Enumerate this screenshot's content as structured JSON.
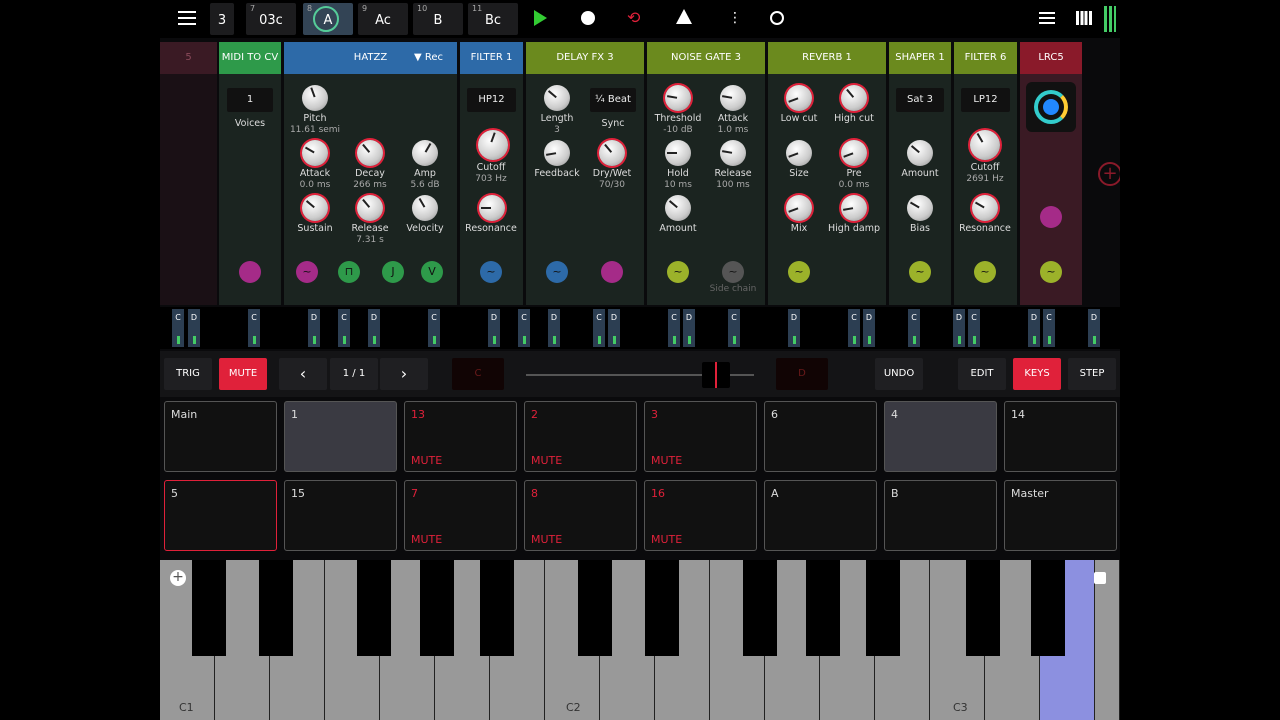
{
  "top": {
    "tabs": [
      {
        "num": "",
        "name": "3"
      },
      {
        "num": "7",
        "name": "03c"
      },
      {
        "num": "8",
        "name": "A"
      },
      {
        "num": "9",
        "name": "Ac"
      },
      {
        "num": "10",
        "name": "B"
      },
      {
        "num": "11",
        "name": "Bc"
      }
    ],
    "icons": [
      "hamburger-icon",
      "play-icon",
      "record-icon",
      "loop-icon",
      "metronome-icon",
      "more-icon",
      "link-icon",
      "list-icon",
      "grid-icon",
      "level-meter-icon"
    ]
  },
  "modules": {
    "m0": {
      "title": "5"
    },
    "midi": {
      "title": "MIDI TO CV",
      "voices_value": "1",
      "voices_label": "Voices"
    },
    "hatzz": {
      "title": "HATZZ",
      "rec": "▼ Rec",
      "pitch": "Pitch",
      "pitch_v": "11.61 semi",
      "attack": "Attack",
      "attack_v": "0.0 ms",
      "decay": "Decay",
      "decay_v": "266 ms",
      "amp": "Amp",
      "amp_v": "5.6 dB",
      "sustain": "Sustain",
      "release": "Release",
      "release_v": "7.31 s",
      "velocity": "Velocity",
      "lfo3": "J",
      "lfo4": "V"
    },
    "filter1": {
      "title": "FILTER 1",
      "mode": "HP12",
      "cutoff": "Cutoff",
      "cutoff_v": "703 Hz",
      "res": "Resonance"
    },
    "delay": {
      "title": "DELAY FX 3",
      "length": "Length",
      "length_v": "3",
      "sync_box": "¼ Beat",
      "sync": "Sync",
      "feedback": "Feedback",
      "drywet": "Dry/Wet",
      "drywet_v": "70/30"
    },
    "gate": {
      "title": "NOISE GATE 3",
      "threshold": "Threshold",
      "threshold_v": "-10 dB",
      "attack": "Attack",
      "attack_v": "1.0 ms",
      "hold": "Hold",
      "hold_v": "10 ms",
      "release": "Release",
      "release_v": "100 ms",
      "amount": "Amount",
      "sidechain": "Side chain"
    },
    "reverb": {
      "title": "REVERB 1",
      "lowcut": "Low cut",
      "highcut": "High cut",
      "size": "Size",
      "pre": "Pre",
      "pre_v": "0.0 ms",
      "mix": "Mix",
      "highdamp": "High damp"
    },
    "shaper": {
      "title": "SHAPER 1",
      "mode": "Sat 3",
      "amount": "Amount",
      "bias": "Bias"
    },
    "filter6": {
      "title": "FILTER 6",
      "mode": "LP12",
      "cutoff": "Cutoff",
      "cutoff_v": "2691 Hz",
      "res": "Resonance"
    },
    "lrc5": {
      "title": "LRC5"
    }
  },
  "minikeys": [
    "C",
    "D",
    "C",
    "D",
    "C",
    "D",
    "C",
    "D",
    "C",
    "D",
    "C",
    "D",
    "C",
    "D",
    "C",
    "D",
    "C",
    "D",
    "C",
    "D",
    "C",
    "D",
    "C",
    "D",
    "C",
    "D",
    "C",
    "D",
    "C",
    "D"
  ],
  "controls": {
    "trig": "TRIG",
    "mute": "MUTE",
    "prev": "‹",
    "page": "1 / 1",
    "next": "›",
    "left_note": "C",
    "right_note": "D",
    "undo": "UNDO",
    "edit": "EDIT",
    "keys": "KEYS",
    "step": "STEP"
  },
  "pads": [
    {
      "name": "Main",
      "mute": ""
    },
    {
      "name": "1",
      "mute": ""
    },
    {
      "name": "13",
      "mute": "MUTE"
    },
    {
      "name": "2",
      "mute": "MUTE"
    },
    {
      "name": "3",
      "mute": "MUTE"
    },
    {
      "name": "6",
      "mute": ""
    },
    {
      "name": "4",
      "mute": ""
    },
    {
      "name": "14",
      "mute": ""
    },
    {
      "name": "5",
      "mute": ""
    },
    {
      "name": "15",
      "mute": ""
    },
    {
      "name": "7",
      "mute": "MUTE"
    },
    {
      "name": "8",
      "mute": "MUTE"
    },
    {
      "name": "16",
      "mute": "MUTE"
    },
    {
      "name": "A",
      "mute": ""
    },
    {
      "name": "B",
      "mute": ""
    },
    {
      "name": "Master",
      "mute": ""
    }
  ],
  "keyboard": {
    "c1": "C1",
    "c2": "C2",
    "c3": "C3"
  },
  "colors": {
    "accent": "#e0213a",
    "green": "#4caf50",
    "blue": "#2d6aa8",
    "olive": "#6b8a1e",
    "maroon": "#8a1a2a"
  }
}
